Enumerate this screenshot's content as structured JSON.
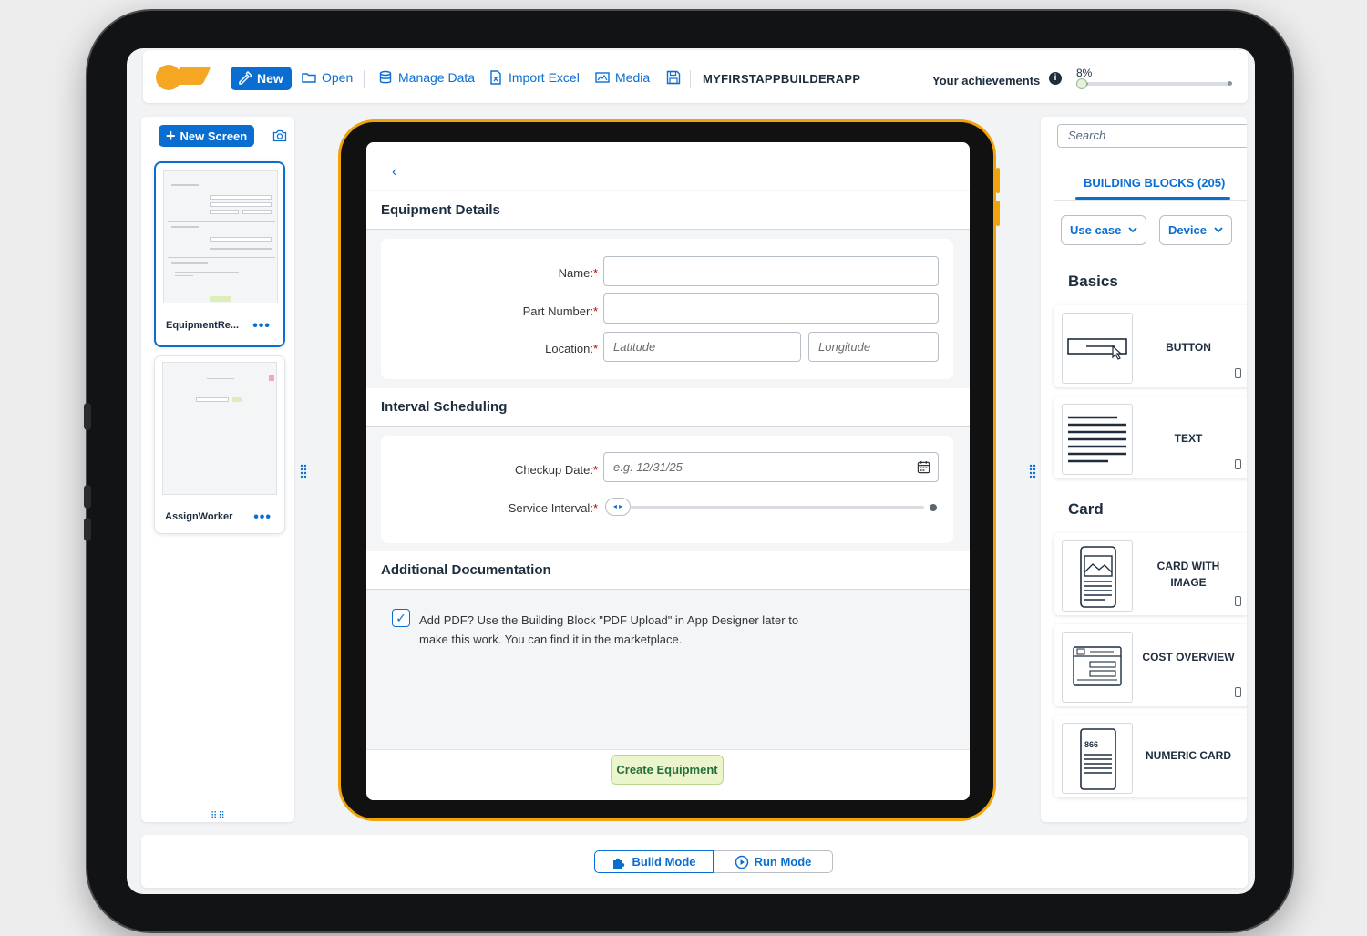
{
  "topbar": {
    "new_label": "New",
    "open_label": "Open",
    "manage_data_label": "Manage Data",
    "import_excel_label": "Import Excel",
    "media_label": "Media",
    "app_name": "MYFIRSTAPPBUILDERAPP",
    "achievements_label": "Your achievements",
    "achievements_info": "i",
    "achievements_percent": "8%",
    "achievements_progress": 0.08
  },
  "left_panel": {
    "new_screen_label": "New Screen",
    "screens": [
      {
        "label": "EquipmentRe...",
        "dots": "•••",
        "active": true
      },
      {
        "label": "AssignWorker",
        "dots": "•••",
        "active": false
      }
    ],
    "grip": "⠿⠿"
  },
  "preview": {
    "back": "‹",
    "section1_title": "Equipment Details",
    "name_label": "Name:",
    "part_number_label": "Part Number:",
    "location_label": "Location:",
    "required_mark": "*",
    "latitude_placeholder": "Latitude",
    "longitude_placeholder": "Longitude",
    "section2_title": "Interval Scheduling",
    "checkup_date_label": "Checkup Date:",
    "checkup_date_placeholder": "e.g. 12/31/25",
    "service_interval_label": "Service Interval:",
    "slider_handle": "◂ ▸",
    "section3_title": "Additional Documentation",
    "checkbox_checked": true,
    "checkbox_mark": "✓",
    "checkbox_text": "Add PDF? Use the Building Block \"PDF Upload\" in App Designer later to make this work. You can find it in the marketplace.",
    "create_button": "Create Equipment"
  },
  "right_panel": {
    "search_placeholder": "Search",
    "tab_label": "BUILDING BLOCKS (205)",
    "use_case_label": "Use case",
    "device_label": "Device",
    "categories": [
      {
        "name": "Basics",
        "blocks": [
          {
            "label": "BUTTON",
            "icon": "button-block-icon"
          },
          {
            "label": "TEXT",
            "icon": "text-block-icon"
          }
        ]
      },
      {
        "name": "Card",
        "blocks": [
          {
            "label": "CARD WITH IMAGE",
            "icon": "card-image-block-icon"
          },
          {
            "label": "COST OVERVIEW",
            "icon": "cost-overview-block-icon"
          },
          {
            "label": "NUMERIC CARD",
            "icon": "numeric-card-block-icon",
            "icon_text": "866"
          }
        ]
      }
    ]
  },
  "bottombar": {
    "build_mode_label": "Build Mode",
    "run_mode_label": "Run Mode"
  },
  "colors": {
    "accent": "#0a6ed1",
    "brand_orange": "#f5a623",
    "tablet_frame": "#f0a30a",
    "create_button_bg": "#ebf5cb",
    "required": "#bb0000"
  }
}
